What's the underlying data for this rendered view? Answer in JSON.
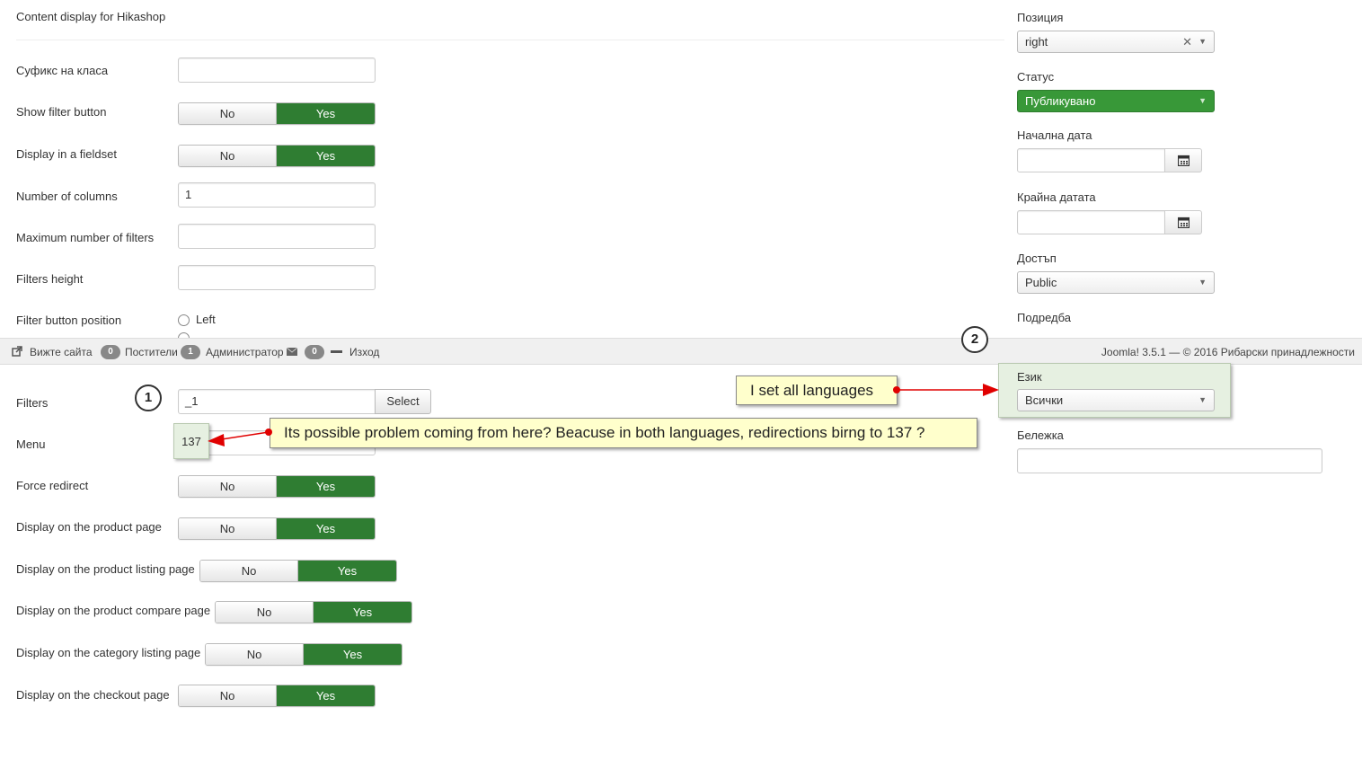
{
  "header": {
    "title": "Content display for Hikashop"
  },
  "form": {
    "class_suffix": {
      "label": "Суфикс на класа",
      "value": ""
    },
    "show_filter_button": {
      "label": "Show filter button",
      "no": "No",
      "yes": "Yes"
    },
    "display_fieldset": {
      "label": "Display in a fieldset",
      "no": "No",
      "yes": "Yes"
    },
    "num_columns": {
      "label": "Number of columns",
      "value": "1"
    },
    "max_filters": {
      "label": "Maximum number of filters",
      "value": ""
    },
    "filters_height": {
      "label": "Filters height",
      "value": ""
    },
    "filter_button_position": {
      "label": "Filter button position",
      "option_left": "Left"
    },
    "filters": {
      "label": "Filters",
      "value": "_1",
      "select_label": "Select"
    },
    "menu": {
      "label": "Menu",
      "value": "137"
    },
    "force_redirect": {
      "label": "Force redirect",
      "no": "No",
      "yes": "Yes"
    },
    "display_product_page": {
      "label": "Display on the product page",
      "no": "No",
      "yes": "Yes"
    },
    "display_product_listing": {
      "label": "Display on the product listing page",
      "no": "No",
      "yes": "Yes"
    },
    "display_product_compare": {
      "label": "Display on the product compare page",
      "no": "No",
      "yes": "Yes"
    },
    "display_category_listing": {
      "label": "Display on the category listing page",
      "no": "No",
      "yes": "Yes"
    },
    "display_checkout": {
      "label": "Display on the checkout page",
      "no": "No",
      "yes": "Yes"
    }
  },
  "sidebar": {
    "position": {
      "label": "Позиция",
      "value": "right"
    },
    "status": {
      "label": "Статус",
      "value": "Публикувано"
    },
    "start_date": {
      "label": "Начална дата",
      "value": ""
    },
    "end_date": {
      "label": "Крайна датата",
      "value": ""
    },
    "access": {
      "label": "Достъп",
      "value": "Public"
    },
    "ordering": {
      "label": "Подредба"
    },
    "language": {
      "label": "Език",
      "value": "Всички"
    },
    "note": {
      "label": "Бележка",
      "value": ""
    }
  },
  "statusbar": {
    "view_site": "Вижте сайта",
    "visitors_count": "0",
    "visitors_label": "Постители",
    "admins_count": "1",
    "admins_label": "Администратор",
    "messages_count": "0",
    "logout": "Изход",
    "footer": "Joomla! 3.5.1  —  © 2016 Рибарски принадлежности"
  },
  "annotations": {
    "marker1": "1",
    "marker2": "2",
    "callout_menu": "Its possible problem coming from here? Beacuse in both languages, redirections birng to 137 ?",
    "callout_language": "I set all languages"
  },
  "colors": {
    "green": "#2f7d32",
    "callout_bg": "#ffffcc",
    "arrow": "#e00000"
  }
}
